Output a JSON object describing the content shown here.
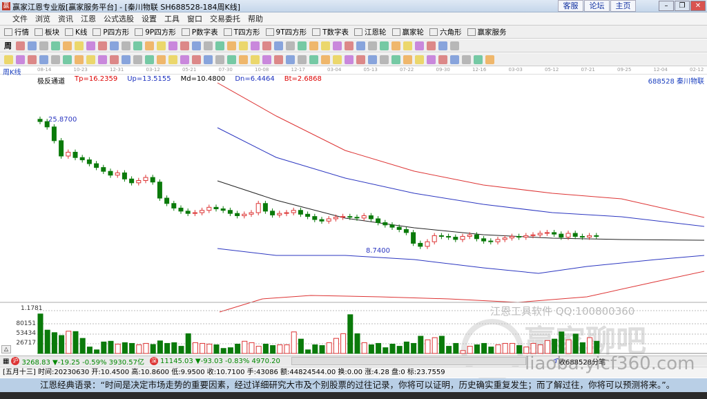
{
  "window": {
    "title": "赢家江恩专业版[赢家服务平台] - [秦川物联  SH688528-184周K线]",
    "links": [
      "客服",
      "论坛",
      "主页"
    ]
  },
  "menu": [
    "文件",
    "浏览",
    "资讯",
    "江恩",
    "公式选股",
    "设置",
    "工具",
    "窗口",
    "交易委托",
    "帮助"
  ],
  "toolbar": [
    {
      "icon": "PS",
      "label": "行情"
    },
    {
      "icon": "板",
      "label": "板块"
    },
    {
      "icon": "K",
      "label": "K线"
    },
    {
      "icon": "PS",
      "label": "P四方形"
    },
    {
      "icon": "P9",
      "label": "9P四方形"
    },
    {
      "icon": "PN",
      "label": "P数字表"
    },
    {
      "icon": "TS",
      "label": "T四方形"
    },
    {
      "icon": "T9",
      "label": "9T四方形"
    },
    {
      "icon": "TN",
      "label": "T数字表"
    },
    {
      "icon": "◎",
      "label": "江恩轮"
    },
    {
      "icon": "◎",
      "label": "赢家轮"
    },
    {
      "icon": "◎",
      "label": "六角形"
    },
    {
      "icon": "$",
      "label": "赢家服务"
    }
  ],
  "period_select": "周",
  "chart": {
    "period_label": "周K线",
    "indicator_name": "极反通道",
    "tp": "Tp=16.2359",
    "up": "Up=13.5155",
    "md": "Md=10.4800",
    "dn": "Dn=6.4464",
    "bt": "Bt=2.6868",
    "stock": "688528 秦川物联",
    "dates": [
      "08-14",
      "10-23",
      "12-31",
      "03-12",
      "05-21",
      "07-30",
      "10-08",
      "12-17",
      "03-04",
      "05-13",
      "07-22",
      "09-30",
      "12-16",
      "03-03",
      "05-12",
      "07-21",
      "09-25",
      "12-04",
      "02-12"
    ],
    "high_label": "25.8700",
    "low_label": "8.7400",
    "vol_ticks": [
      "1.1781",
      "80151",
      "53434",
      "26717"
    ],
    "watermark": "江恩工具软件  QQ:100800360",
    "watermark2": "赢家聊吧",
    "watermark3": "liaoba.yicf360.com"
  },
  "chart_data": {
    "type": "candlestick",
    "closes": [
      25.5,
      24.8,
      23,
      21,
      21.5,
      20.8,
      20.5,
      20,
      19.5,
      19,
      18.5,
      18.8,
      18,
      17.5,
      17.8,
      18.2,
      17.6,
      15.5,
      14.8,
      14.2,
      13.8,
      13.5,
      13.6,
      13.9,
      14.3,
      14.1,
      13.9,
      13.5,
      13.2,
      13.4,
      13.6,
      14.8,
      13.8,
      13.3,
      13.5,
      13.6,
      13.9,
      13.4,
      13.1,
      12.7,
      12.5,
      12.8,
      13,
      13.1,
      13.0,
      12.9,
      13.2,
      12.8,
      12.3,
      12,
      11.7,
      11.4,
      11,
      9.6,
      9.2,
      9.8,
      10.6,
      10.5,
      10.4,
      10.1,
      10.5,
      10.7,
      10.2,
      9.9,
      9.8,
      10.1,
      10.3,
      10.5,
      10.4,
      10.6,
      10.7,
      10.9,
      11,
      10.8,
      10.4,
      10.9,
      10.5,
      10.4,
      10.6,
      10.5
    ],
    "volumes": [
      110,
      65,
      58,
      50,
      62,
      61,
      42,
      18,
      10,
      32,
      34,
      26,
      30,
      28,
      24,
      28,
      25,
      35,
      28,
      30,
      20,
      55,
      30,
      28,
      26,
      24,
      14,
      16,
      26,
      34,
      30,
      20,
      26,
      22,
      24,
      24,
      60,
      40,
      10,
      24,
      22,
      30,
      42,
      55,
      108,
      55,
      30,
      24,
      28,
      16,
      26,
      20,
      32,
      28,
      48,
      38,
      44,
      48,
      20,
      28,
      8,
      20,
      24,
      28,
      18,
      24,
      28,
      28,
      22,
      18,
      28,
      24,
      36,
      40,
      60,
      38,
      54,
      30,
      44,
      34
    ],
    "high": 25.87,
    "low": 8.74,
    "bands": {
      "tp": 16.2359,
      "up": 13.5155,
      "md": 10.48,
      "dn": 6.4464,
      "bt": 2.6868
    }
  },
  "status": {
    "sh": "3268.83 ▼-19.25 -0.59% 3930.57亿",
    "sz": "11145.03 ▼-93.03 -0.83% 4970.20",
    "feed": "收688528分笔",
    "detail": "[五月十三] 时间:20230630 开:10.4500 高:10.8600 低:9.9500 收:10.7100 手:43086 额:44824544.00 换:0.00 涨:4.28 盘:0 标:23.7559"
  },
  "quote": "江恩经典语录：“时间是决定市场走势的重要因素，经过详细研究大市及个别股票的过往记录，你将可以证明，历史确实重复发生；而了解过往，你将可以预测将来。”。"
}
